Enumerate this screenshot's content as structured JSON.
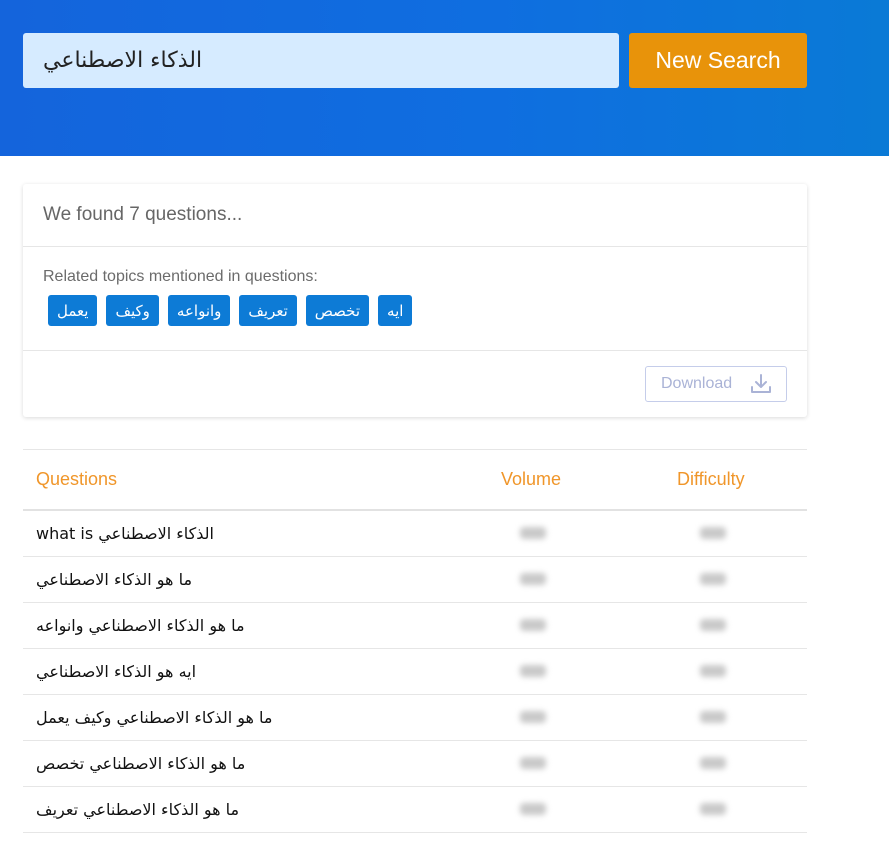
{
  "search": {
    "query": "الذكاء الاصطناعي",
    "button_label": "New Search"
  },
  "results": {
    "summary": "We found 7 questions...",
    "topics_label": "Related topics mentioned in questions:",
    "topics": [
      "يعمل",
      "وكيف",
      "وانواعه",
      "تعريف",
      "تخصص",
      "ايه"
    ],
    "download_label": "Download"
  },
  "table": {
    "headers": {
      "questions": "Questions",
      "volume": "Volume",
      "difficulty": "Difficulty"
    },
    "rows": [
      {
        "question": "what is الذكاء الاصطناعي"
      },
      {
        "question": "ما هو الذكاء الاصطناعي"
      },
      {
        "question": "ما هو الذكاء الاصطناعي وانواعه"
      },
      {
        "question": "ايه هو الذكاء الاصطناعي"
      },
      {
        "question": "ما هو الذكاء الاصطناعي وكيف يعمل"
      },
      {
        "question": "ما هو الذكاء الاصطناعي تخصص"
      },
      {
        "question": "ما هو الذكاء الاصطناعي تعريف"
      }
    ]
  },
  "colors": {
    "header_bg": "#1464dc",
    "accent_orange": "#e8930a",
    "chip_blue": "#0d7bd6",
    "header_text_orange": "#f0962a"
  },
  "icons": {
    "download": "download-icon"
  }
}
